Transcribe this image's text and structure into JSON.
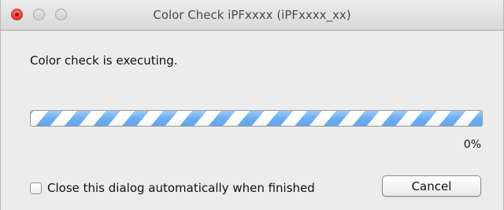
{
  "window": {
    "title": "Color Check iPFxxxx (iPFxxxx_xx)"
  },
  "dialog": {
    "message": "Color check is executing.",
    "progress_percent": 0,
    "progress_label": "0%",
    "auto_close_checkbox": {
      "label": "Close this dialog automatically when finished",
      "checked": false
    },
    "cancel_label": "Cancel"
  },
  "colors": {
    "progress_stripe": "#6aaef2",
    "close_button": "#f0443a"
  }
}
